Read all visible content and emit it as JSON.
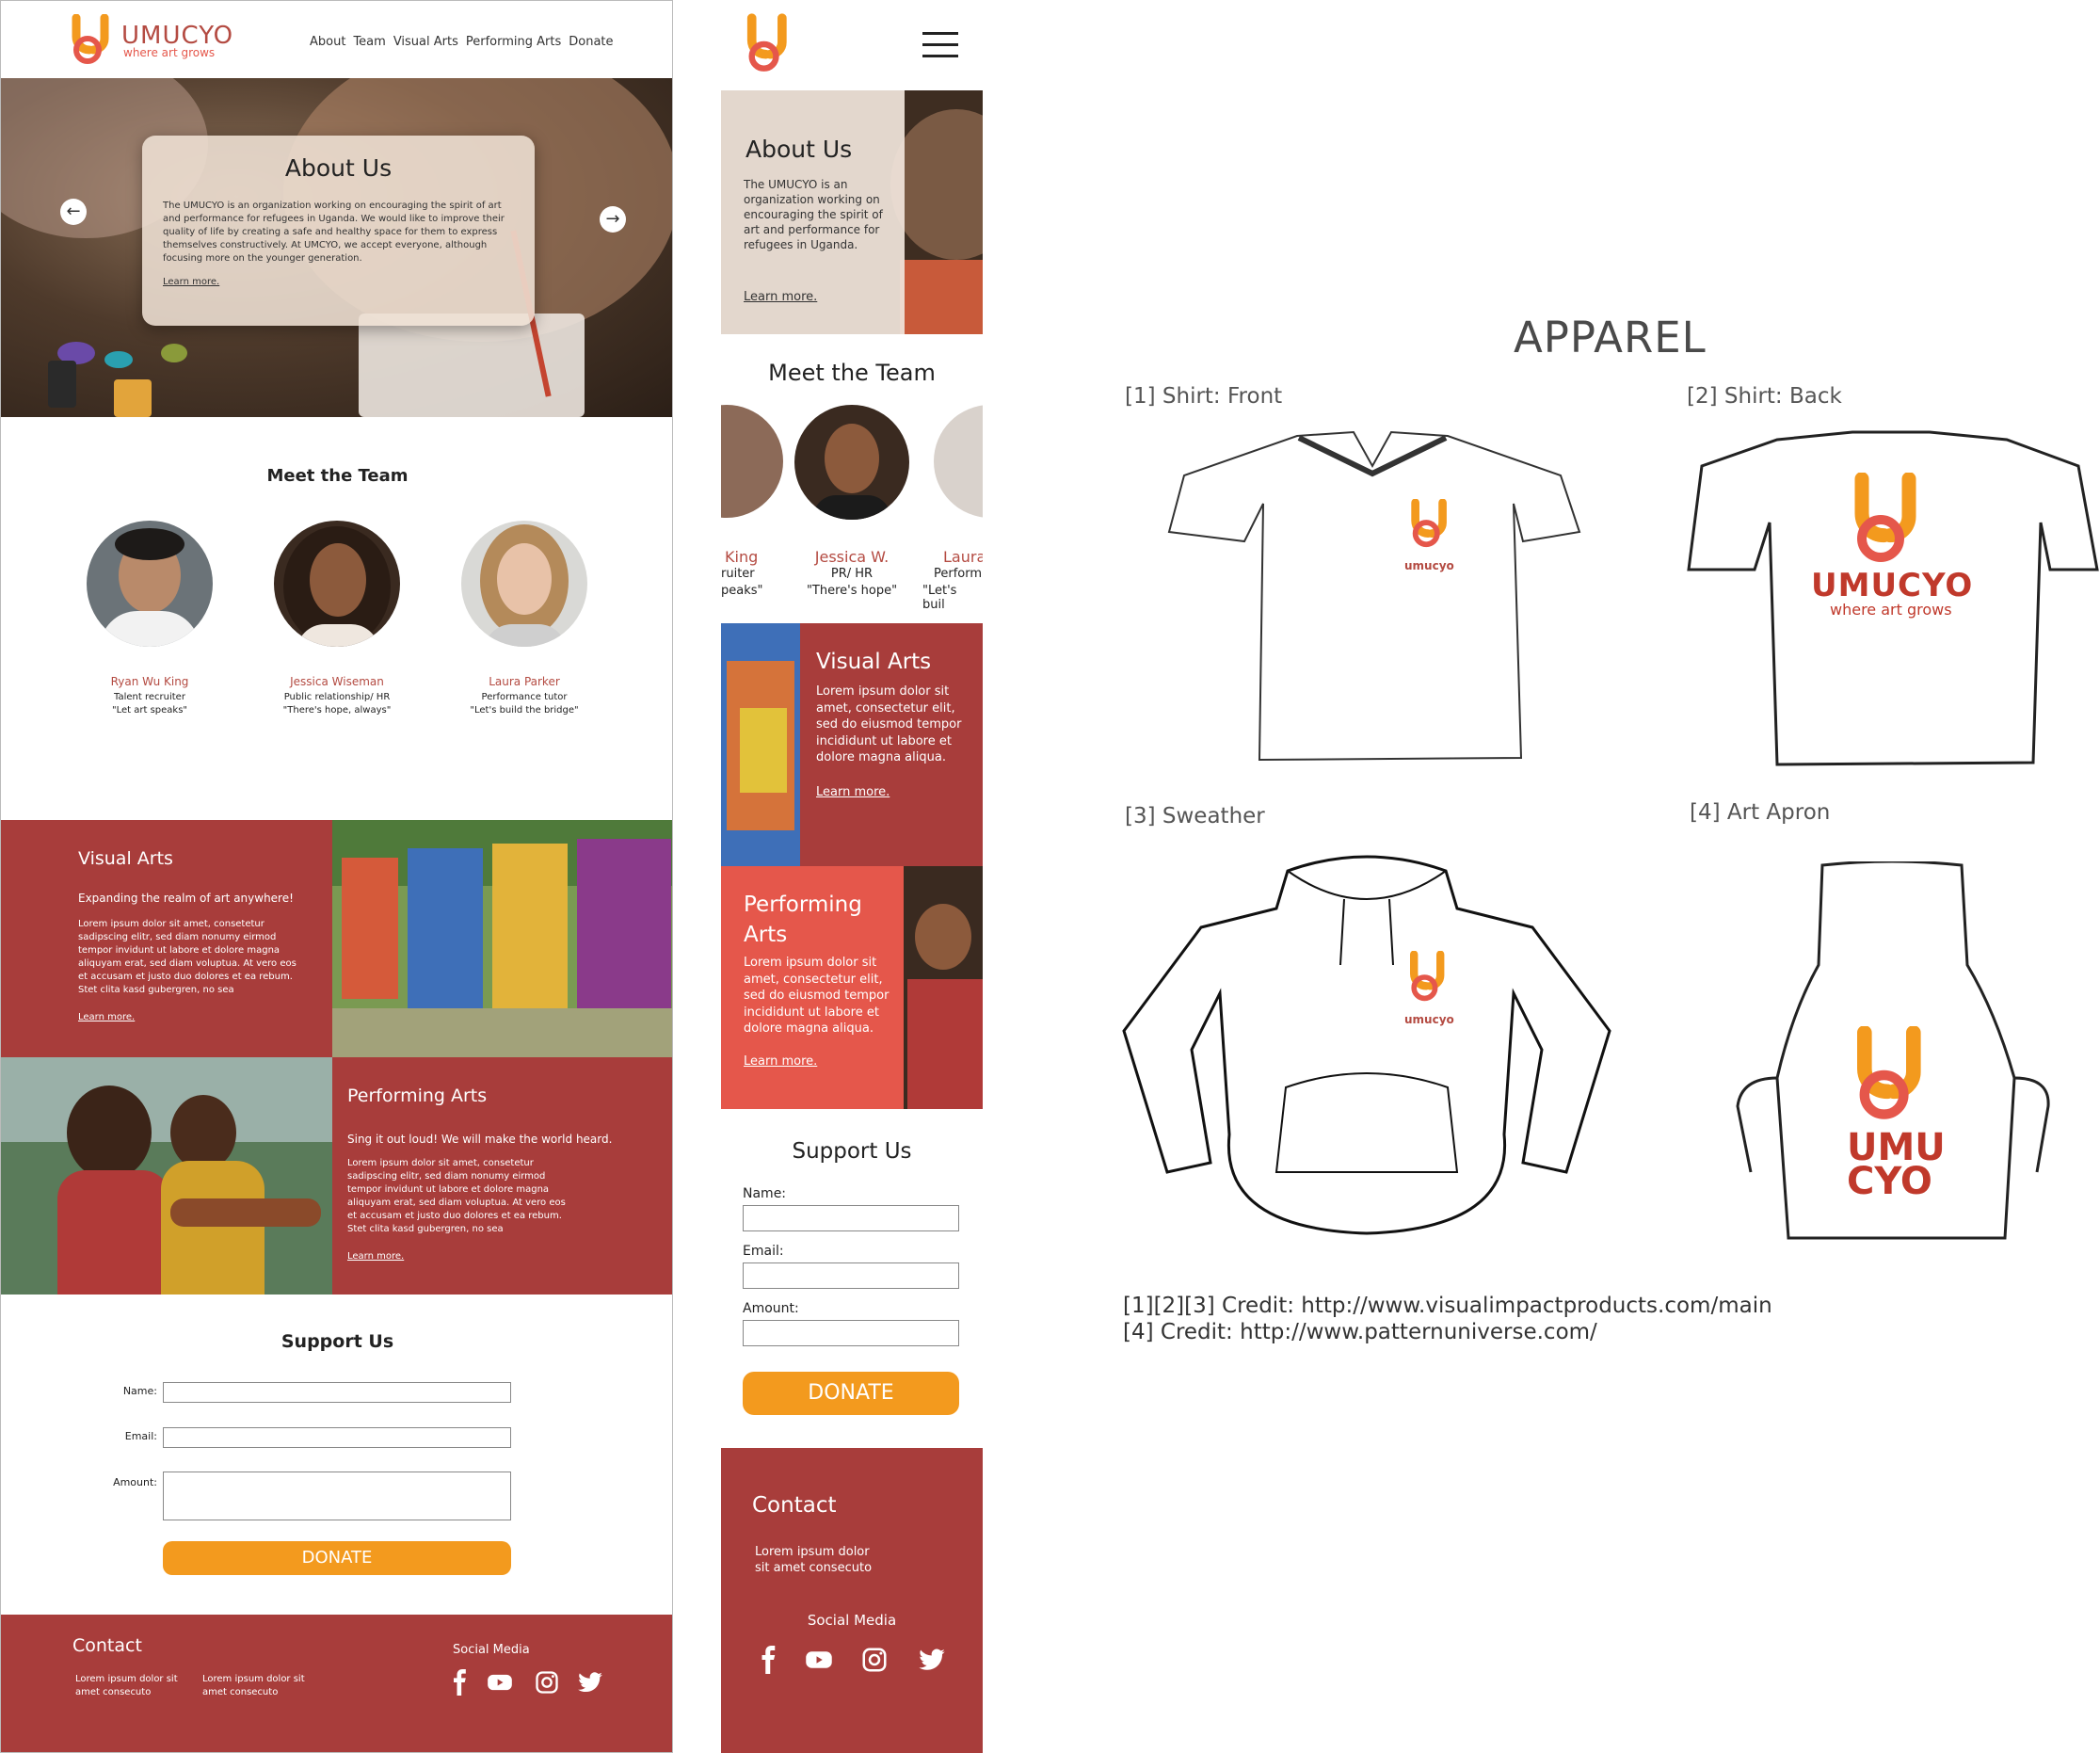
{
  "brand": {
    "name": "UMUCYO",
    "tagline": "where art grows",
    "colors": {
      "orange": "#f39a1e",
      "red": "#e5574b",
      "maroon": "#a83d3b"
    }
  },
  "desktop": {
    "nav": [
      "About",
      "Team",
      "Visual Arts",
      "Performing Arts",
      "Donate"
    ],
    "about": {
      "title": "About Us",
      "text": "The UMUCYO is an organization working on encouraging the spirit of art and performance for refugees in Uganda. We would like to improve their quality of life by creating a safe and healthy space for them to express themselves constructively. At UMCYO, we accept everyone, although focusing more on the younger generation.",
      "link": "Learn more."
    },
    "team": {
      "title": "Meet the Team",
      "members": [
        {
          "name": "Ryan Wu King",
          "role": "Talent recruiter",
          "quote": "\"Let art speaks\""
        },
        {
          "name": "Jessica Wiseman",
          "role": "Public relationship/ HR",
          "quote": "\"There's hope, always\""
        },
        {
          "name": "Laura Parker",
          "role": "Performance tutor",
          "quote": "\"Let's build the bridge\""
        }
      ]
    },
    "visual_arts": {
      "title": "Visual Arts",
      "subtitle": "Expanding the realm of art anywhere!",
      "body": "Lorem ipsum dolor sit amet, consetetur sadipscing elitr, sed diam nonumy eirmod tempor invidunt ut labore et dolore magna aliquyam erat, sed diam voluptua. At vero eos et accusam et justo duo dolores et ea rebum. Stet clita kasd gubergren, no sea",
      "link": "Learn more."
    },
    "performing_arts": {
      "title": "Performing Arts",
      "subtitle": "Sing it out loud! We will make the world heard.",
      "body": "Lorem ipsum dolor sit amet, consetetur sadipscing elitr, sed diam nonumy eirmod tempor invidunt ut labore et dolore magna aliquyam erat, sed diam voluptua. At vero eos et accusam et justo duo dolores et ea rebum. Stet clita kasd gubergren, no sea",
      "link": "Learn more."
    },
    "support": {
      "title": "Support Us",
      "name_label": "Name:",
      "email_label": "Email:",
      "amount_label": "Amount:",
      "donate": "DONATE"
    },
    "footer": {
      "contact_title": "Contact",
      "contact_col1": "Lorem ipsum dolor sit amet consecuto",
      "contact_col2": "Lorem ipsum dolor sit amet consecuto",
      "social_title": "Social Media",
      "social_icons": [
        "facebook-icon",
        "youtube-icon",
        "instagram-icon",
        "twitter-icon"
      ]
    }
  },
  "mobile": {
    "about": {
      "title": "About Us",
      "text": "The UMUCYO is an organization working on encouraging the spirit of art and performance for refugees in Uganda.",
      "link": "Learn more."
    },
    "team": {
      "title": "Meet the Team",
      "left_partial": {
        "name": "King",
        "role": "ruiter",
        "quote": "peaks\""
      },
      "center": {
        "name": "Jessica W.",
        "role": "PR/ HR",
        "quote": "\"There's hope\""
      },
      "right_partial": {
        "name": "Laura",
        "role": "Perform",
        "quote": "\"Let's buil"
      }
    },
    "visual_arts": {
      "title": "Visual Arts",
      "body": "Lorem ipsum dolor sit amet, consectetur elit, sed do eiusmod tempor incididunt ut labore et dolore magna aliqua.",
      "link": "Learn more."
    },
    "performing_arts": {
      "title_line1": "Performing",
      "title_line2": "Arts",
      "body": "Lorem ipsum dolor sit amet, consectetur elit, sed do eiusmod tempor incididunt ut labore et dolore magna aliqua.",
      "link": "Learn more."
    },
    "support": {
      "title": "Support Us",
      "name_label": "Name:",
      "email_label": "Email:",
      "amount_label": "Amount:",
      "donate": "DONATE"
    },
    "footer": {
      "contact_title": "Contact",
      "contact_text": "Lorem ipsum dolor sit amet consecuto",
      "social_title": "Social Media"
    }
  },
  "apparel": {
    "title": "APPAREL",
    "items": [
      {
        "label": "[1] Shirt: Front"
      },
      {
        "label": "[2]  Shirt: Back"
      },
      {
        "label": "[3] Sweather"
      },
      {
        "label": "[4] Art Apron"
      }
    ],
    "shirt_back_brand": "UMUCYO",
    "shirt_back_tagline": "where art grows",
    "small_brand": "umucyo",
    "apron_line1": "UMU",
    "apron_line2": "CYO",
    "credits": [
      "[1][2][3]  Credit: http://www.visualimpactproducts.com/main",
      "[4]  Credit: http://www.patternuniverse.com/"
    ]
  }
}
